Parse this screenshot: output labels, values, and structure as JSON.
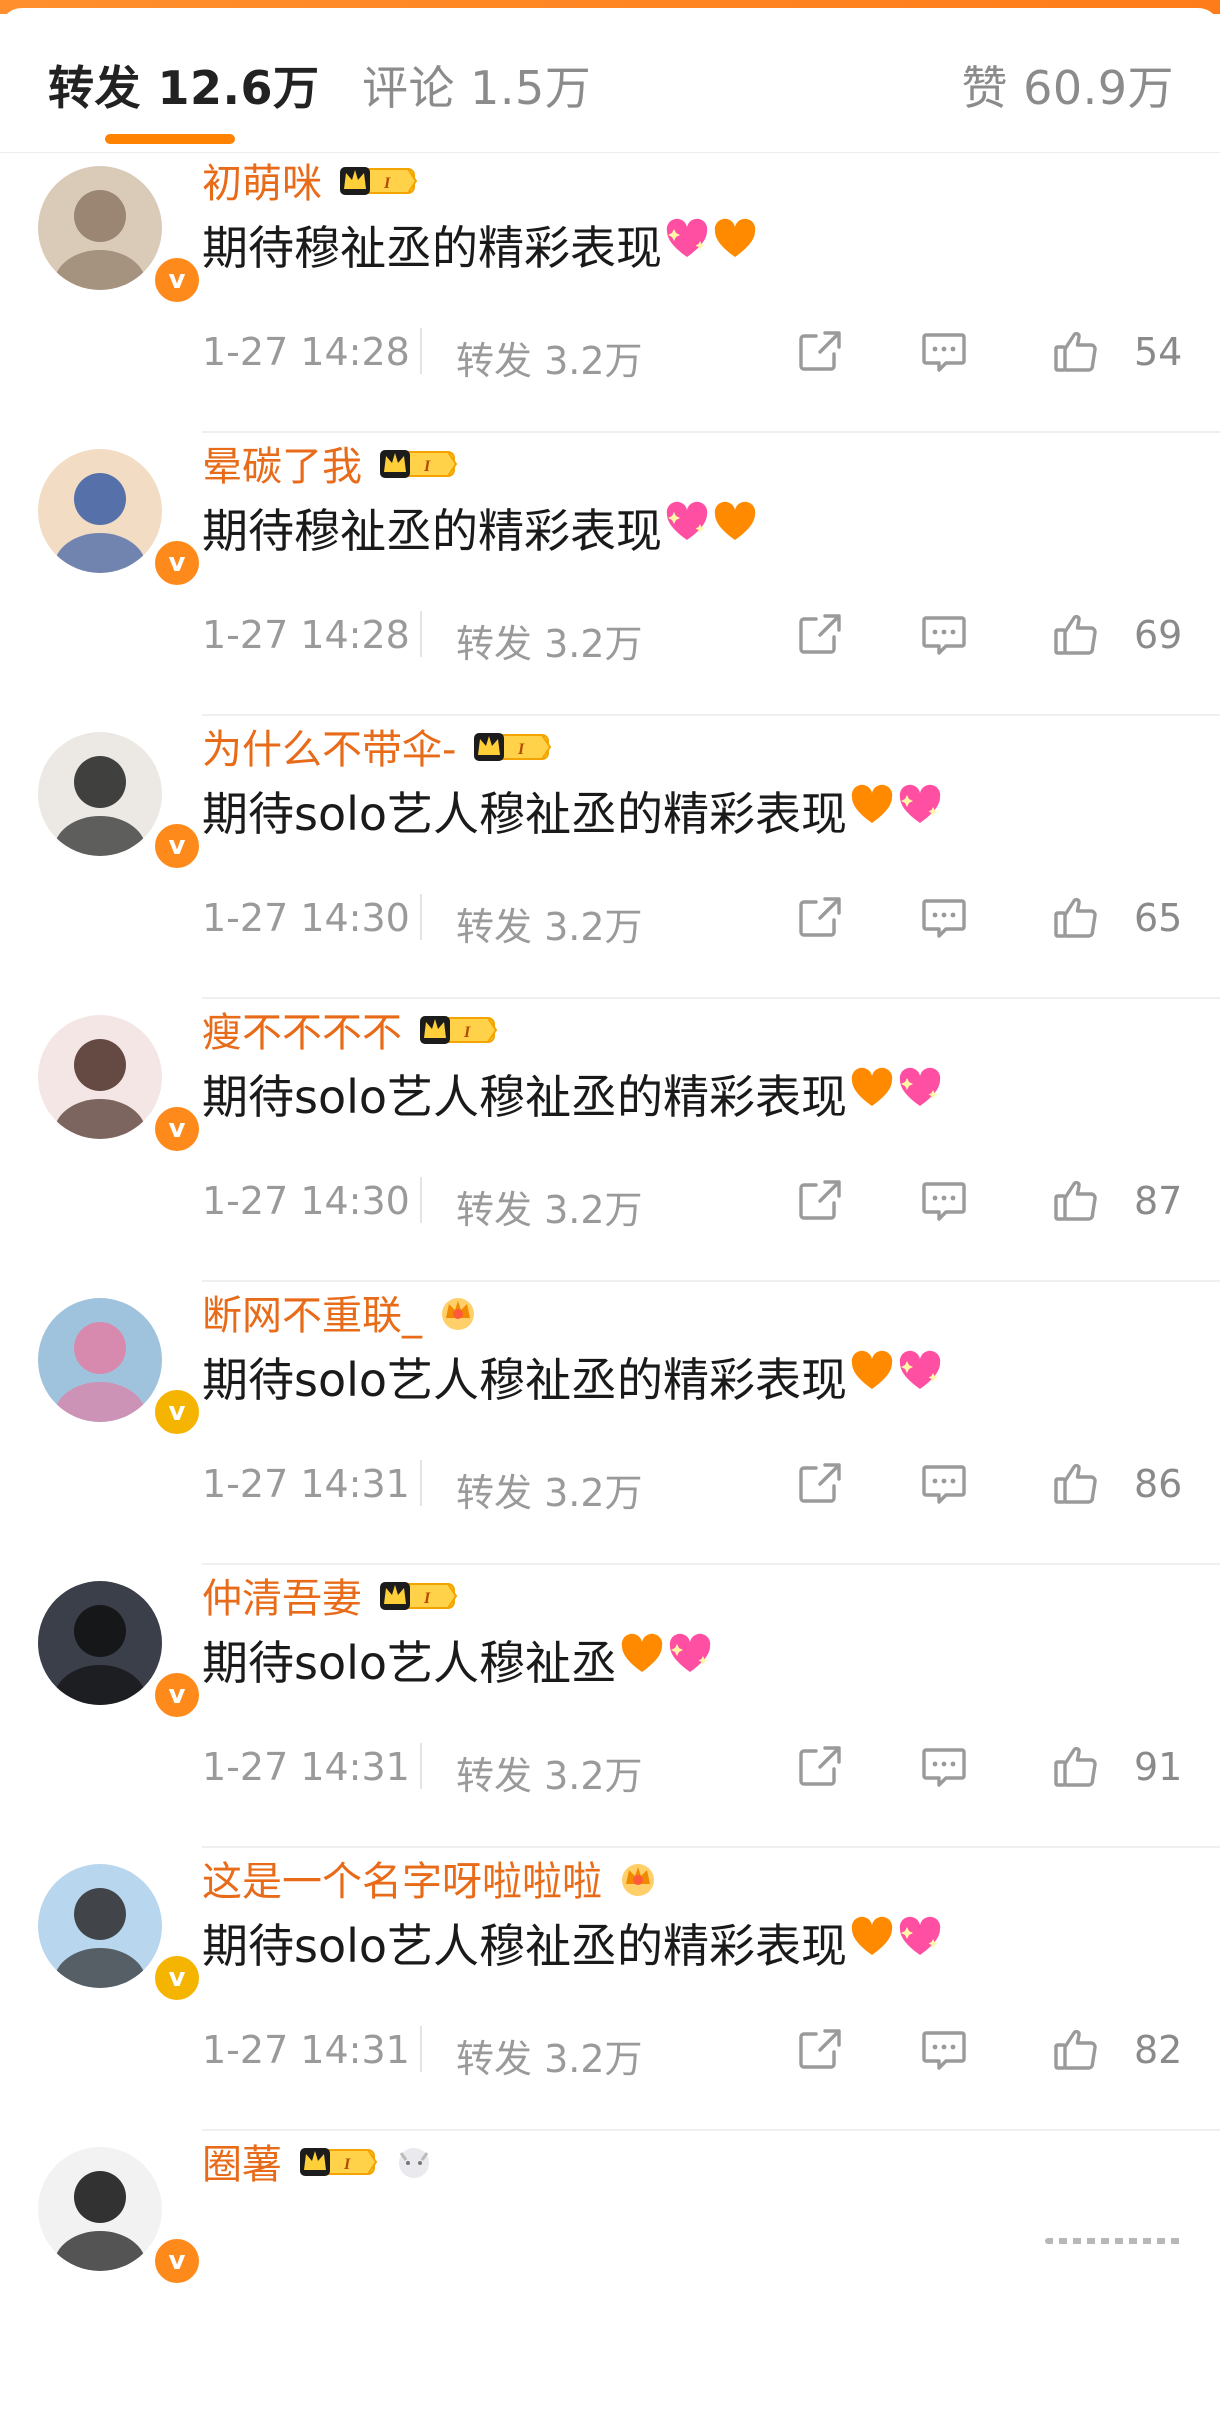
{
  "tabs": {
    "repost": "转发 12.6万",
    "comment": "评论 1.5万",
    "likes": "赞 60.9万"
  },
  "colors": {
    "accent": "#ff8200",
    "username": "#e86b1a",
    "meta": "#9a9a9a"
  },
  "comments": [
    {
      "username": "初萌咪",
      "vip_level": "1",
      "text": "期待穆祉丞的精彩表现",
      "emojis": [
        "sparkling-heart",
        "orange-heart"
      ],
      "time": "1-27 14:28",
      "repost": "转发 3.2万",
      "likes": "54",
      "verified": "orange"
    },
    {
      "username": "晕碳了我",
      "vip_level": "1",
      "text": "期待穆祉丞的精彩表现",
      "emojis": [
        "sparkling-heart",
        "orange-heart"
      ],
      "time": "1-27 14:28",
      "repost": "转发 3.2万",
      "likes": "69",
      "verified": "orange"
    },
    {
      "username": "为什么不带伞-",
      "vip_level": "1",
      "text": "期待solo艺人穆祉丞的精彩表现",
      "emojis": [
        "orange-heart",
        "sparkling-heart"
      ],
      "time": "1-27 14:30",
      "repost": "转发 3.2万",
      "likes": "65",
      "verified": "orange"
    },
    {
      "username": "瘦不不不不",
      "vip_level": "1",
      "text": "期待solo艺人穆祉丞的精彩表现",
      "emojis": [
        "orange-heart",
        "sparkling-heart"
      ],
      "time": "1-27 14:30",
      "repost": "转发 3.2万",
      "likes": "87",
      "verified": "orange"
    },
    {
      "username": "断网不重联_",
      "vip_level": "",
      "text": "期待solo艺人穆祉丞的精彩表现",
      "emojis": [
        "orange-heart",
        "sparkling-heart"
      ],
      "time": "1-27 14:31",
      "repost": "转发 3.2万",
      "likes": "86",
      "verified": "gold"
    },
    {
      "username": "仲清吾妻",
      "vip_level": "1",
      "text": "期待solo艺人穆祉丞",
      "emojis": [
        "orange-heart",
        "sparkling-heart"
      ],
      "time": "1-27 14:31",
      "repost": "转发 3.2万",
      "likes": "91",
      "verified": "orange"
    },
    {
      "username": "这是一个名字呀啦啦啦",
      "vip_level": "",
      "text": "期待solo艺人穆祉丞的精彩表现",
      "emojis": [
        "orange-heart",
        "sparkling-heart"
      ],
      "time": "1-27 14:31",
      "repost": "转发 3.2万",
      "likes": "82",
      "verified": "gold"
    },
    {
      "username": "圈薯",
      "vip_level": "1",
      "text": "",
      "emojis": [],
      "time": "",
      "repost": "",
      "likes": "",
      "verified": "orange"
    }
  ]
}
